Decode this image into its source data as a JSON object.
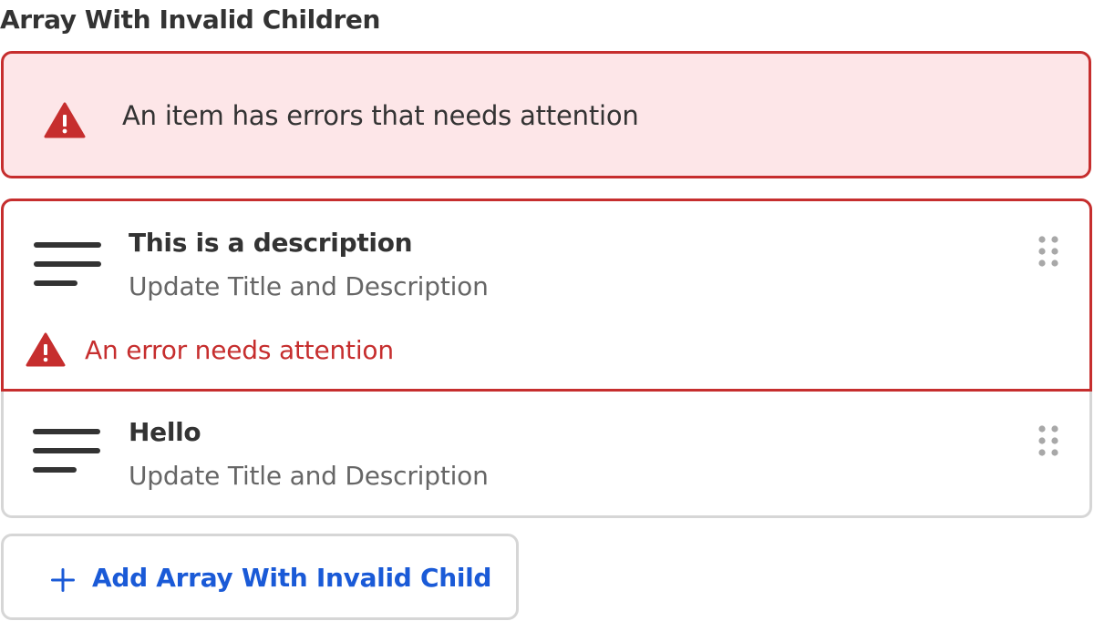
{
  "field": {
    "title": "Array With Invalid Children"
  },
  "error_banner": {
    "icon": "warning-triangle-icon",
    "message": "An item has errors that needs attention"
  },
  "items": [
    {
      "title": "This is a description",
      "subtitle": "Update Title and Description",
      "icon": "text-lines-icon",
      "error": "An error needs attention",
      "invalid": true
    },
    {
      "title": "Hello",
      "subtitle": "Update Title and Description",
      "icon": "text-lines-icon",
      "invalid": false
    }
  ],
  "add_button": {
    "label": "Add Array With Invalid Child",
    "icon": "plus-icon"
  },
  "colors": {
    "error": "#c62e2e",
    "error_background": "#fde6e8",
    "link": "#1a5ad7",
    "border": "#d6d6d6",
    "text": "#333333",
    "muted_text": "#666666"
  }
}
